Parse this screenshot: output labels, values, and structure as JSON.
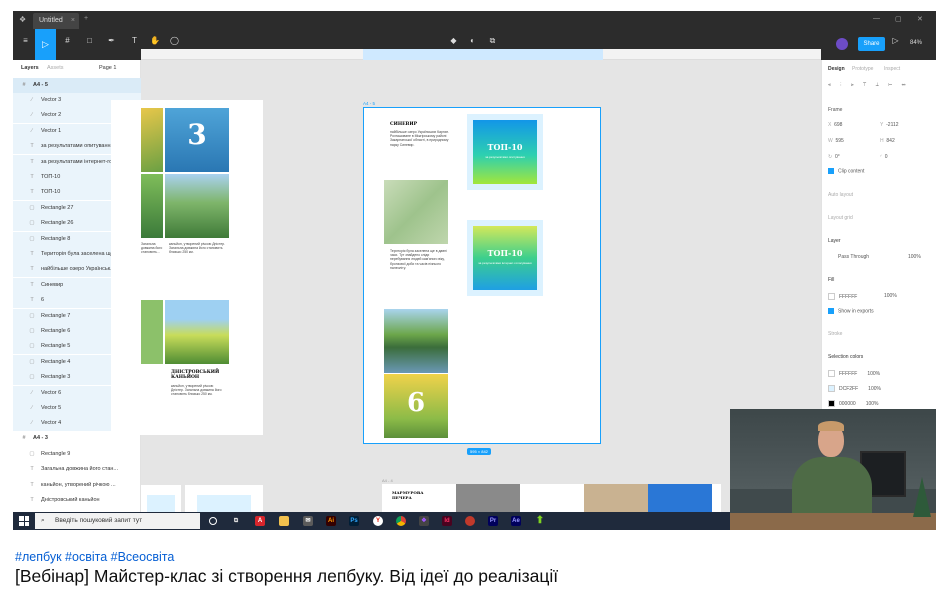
{
  "window": {
    "tab_title": "Untitled",
    "zoom": "84%",
    "share_label": "Share"
  },
  "layers_panel": {
    "tabs": [
      "Layers",
      "Assets"
    ],
    "page_label": "Page 1",
    "frame_a4_5": "A4 - 5",
    "items": [
      "Vector 3",
      "Vector 2",
      "Vector 1",
      "за результатами опитування ...",
      "за результатами інтернет-го...",
      "ТОП-10",
      "ТОП-10",
      "Rectangle 27",
      "Rectangle 26",
      "Rectangle 8",
      "Територія була заселена ще з ...",
      "найбільше озеро Українськ...",
      "Синевир",
      "6",
      "Rectangle 7",
      "Rectangle 6",
      "Rectangle 5",
      "Rectangle 4",
      "Rectangle 3",
      "Vector 6",
      "Vector 5",
      "Vector 4"
    ],
    "frame_a4_3": "A4 - 3",
    "items2": [
      "Rectangle 9",
      "Загальна довжина його стан...",
      "каньйон, утворений річкою ...",
      "Дністровський каньйон"
    ]
  },
  "canvas": {
    "frame_label": "A4 - 5",
    "frame_label_2": "A4 - 4",
    "size_badge": "595 × 842",
    "sinevir_title": "СИНЕВИР",
    "sinevir_text": "найбільше озеро Українських Карпат. Розташоване в Міжгірському районі Закарпатської області, в природному парку Синевир.",
    "territory_text": "Територія була заселена ще в давні часи. Тут знайдено сліди перебування людей кам'яного віку, бронзової доби та часів пізнього палеоліту.",
    "top10_a": "ТОП-10",
    "top10_a_sub": "за результатами опитування",
    "top10_b": "ТОП-10",
    "top10_b_sub": "за результатами інтернет-голосування",
    "number_6": "6",
    "number_3": "3",
    "dnister_title": "ДНІСТРОВСЬКИЙ КАНЬЙОН",
    "dnister_text": "каньйон, утворений річкою Дністер. Загальна довжина його становить близько 250 км.",
    "bottom_left_title": "МАРМУРОВА ПЕЧЕРА"
  },
  "design_panel": {
    "tabs": [
      "Design",
      "Prototype",
      "Inspect"
    ],
    "frame_section": "Frame",
    "x": "698",
    "y": "-2112",
    "w": "595",
    "h": "842",
    "r": "0°",
    "radius": "0",
    "clip_content": "Clip content",
    "auto_layout": "Auto layout",
    "layout_grid": "Layout grid",
    "layer_section": "Layer",
    "pass_through": "Pass Through",
    "layer_opacity": "100%",
    "fill_section": "Fill",
    "fill_hex": "FFFFFF",
    "fill_opacity": "100%",
    "show_exports": "Show in exports",
    "stroke": "Stroke",
    "selection_colors": "Selection colors",
    "colors": [
      {
        "hex": "FFFFFF",
        "pct": "100%",
        "swatch": "#ffffff"
      },
      {
        "hex": "DCF2FF",
        "pct": "100%",
        "swatch": "#dcf2ff"
      },
      {
        "hex": "000000",
        "pct": "100%",
        "swatch": "#000000"
      }
    ]
  },
  "taskbar": {
    "search_placeholder": "Введіть пошуковий запит тут"
  },
  "video": {
    "hashtags": "#лепбук #освіта #Всеосвіта",
    "title": "[Вебінар] Майстер-клас зі створення лепбуку. Від ідеї до реалізації"
  }
}
